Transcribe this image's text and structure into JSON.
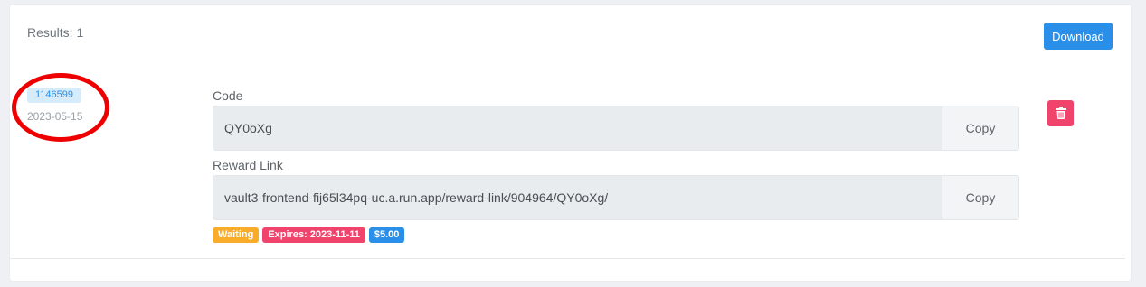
{
  "results": {
    "text": "Results: 1"
  },
  "toolbar": {
    "download_label": "Download"
  },
  "reward": {
    "id": "1146599",
    "date": "2023-05-15",
    "code_label": "Code",
    "code_value": "QY0oXg",
    "link_label": "Reward Link",
    "link_value": "vault3-frontend-fij65l34pq-uc.a.run.app/reward-link/904964/QY0oXg/",
    "copy_label": "Copy",
    "tags": {
      "status": "Waiting",
      "expires": "Expires: 2023-11-11",
      "amount": "$5.00"
    }
  },
  "colors": {
    "accent": "#2a8fe8",
    "waiting": "#f8ac2a",
    "expires": "#f1446c",
    "amount": "#2a8fe8",
    "delete": "#f1446c",
    "annotation": "#ee0000"
  },
  "icons": {
    "delete": "trash-icon"
  }
}
